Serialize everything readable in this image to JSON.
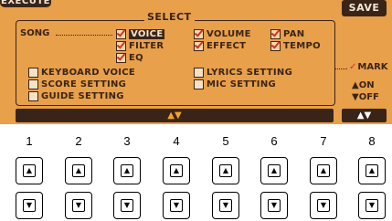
{
  "header": {
    "execute_label": "EXECUTE",
    "save_label": "SAVE",
    "select_title": "SELECT",
    "song_label": "SONG"
  },
  "song_options": [
    {
      "label": "VOICE",
      "checked": true,
      "highlighted": true
    },
    {
      "label": "FILTER",
      "checked": true,
      "highlighted": false
    },
    {
      "label": "EQ",
      "checked": true,
      "highlighted": false
    },
    {
      "label": "VOLUME",
      "checked": true,
      "highlighted": false
    },
    {
      "label": "EFFECT",
      "checked": true,
      "highlighted": false
    },
    {
      "label": "PAN",
      "checked": true,
      "highlighted": false
    },
    {
      "label": "TEMPO",
      "checked": true,
      "highlighted": false
    }
  ],
  "other_options": [
    {
      "label": "KEYBOARD VOICE",
      "checked": false
    },
    {
      "label": "SCORE SETTING",
      "checked": false
    },
    {
      "label": "GUIDE SETTING",
      "checked": false
    },
    {
      "label": "LYRICS SETTING",
      "checked": false
    },
    {
      "label": "MIC SETTING",
      "checked": false
    }
  ],
  "mark": {
    "label": "MARK",
    "on_label": "▲ON",
    "off_label": "▼OFF"
  },
  "nav": {
    "arrows": "▲▼",
    "updown_label": "▲▼"
  },
  "buttons": {
    "numbers": [
      "1",
      "2",
      "3",
      "4",
      "5",
      "6",
      "7",
      "8"
    ],
    "up_glyph": "▲",
    "down_glyph": "▼"
  },
  "colors": {
    "lcd_background": "#e8a04a",
    "dark": "#3a2418",
    "check_red": "#d0312a",
    "arrow_orange": "#f7a41f"
  }
}
